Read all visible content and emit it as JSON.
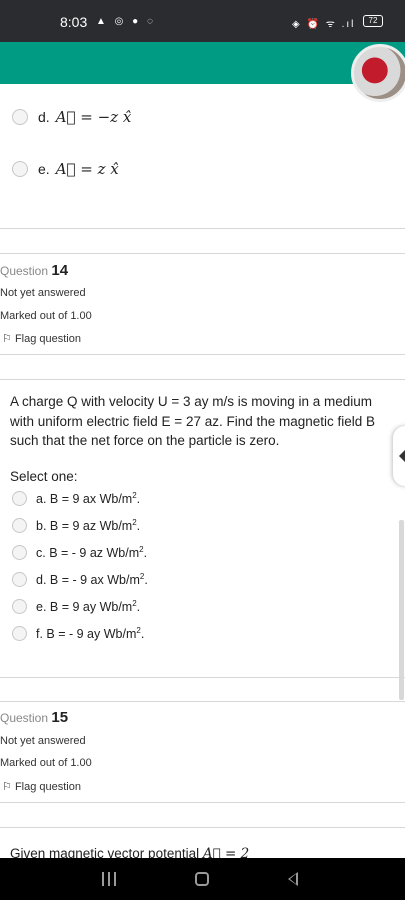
{
  "status_bar": {
    "time": "8:03",
    "left_icons": "▲ ◎ ● ◌",
    "right_icons": "◈ ⏰ ᯤ .ıl",
    "battery": "72"
  },
  "prev_question_options": [
    {
      "label": "d.",
      "math": "A⃗ = −z x̂"
    },
    {
      "label": "e.",
      "math": "A⃗ = z x̂"
    }
  ],
  "question14": {
    "prefix": "Question",
    "number": "14",
    "status": "Not yet answered",
    "marks": "Marked out of 1.00",
    "flag_label": "Flag question",
    "text": "A charge Q with velocity U = 3 ay m/s is moving in a medium with uniform electric field E = 27 az. Find the magnetic field B such that the net force on the particle is zero.",
    "select_label": "Select one:",
    "options": [
      {
        "text": "a. B = 9 ax Wb/m",
        "sup": "2",
        "end": "."
      },
      {
        "text": "b. B = 9 az Wb/m",
        "sup": "2",
        "end": "."
      },
      {
        "text": "c. B = - 9 az Wb/m",
        "sup": "2",
        "end": "."
      },
      {
        "text": "d. B = - 9 ax Wb/m",
        "sup": "2",
        "end": "."
      },
      {
        "text": "e. B = 9 ay Wb/m",
        "sup": "2",
        "end": "."
      },
      {
        "text": "f. B = - 9 ay Wb/m",
        "sup": "2",
        "end": "."
      }
    ]
  },
  "question15": {
    "prefix": "Question",
    "number": "15",
    "status": "Not yet answered",
    "marks": "Marked out of 1.00",
    "flag_label": "Flag question",
    "text_start": "Given magnetic vector potential",
    "text_math": "A⃗ = 2"
  }
}
